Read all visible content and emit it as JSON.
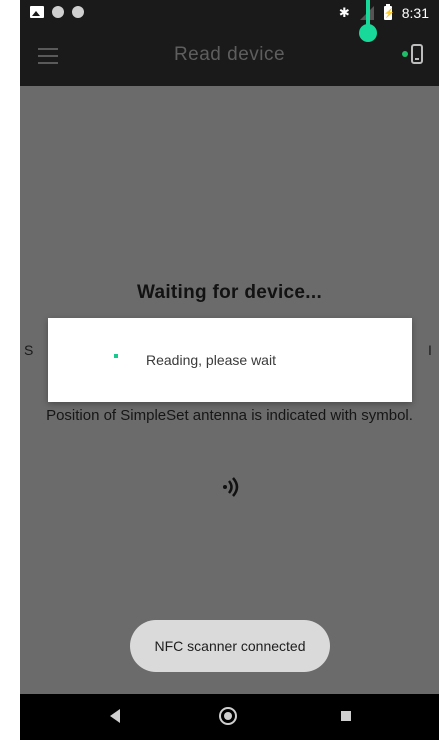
{
  "status_bar": {
    "time": "8:31",
    "bluetooth_icon": "bluetooth-icon"
  },
  "app_bar": {
    "title": "Read device",
    "menu_icon": "hamburger-menu-icon",
    "device_status_color": "#1fbf6a"
  },
  "content": {
    "waiting_title": "Waiting for device...",
    "obscured_left": "S",
    "obscured_right": "I",
    "position_text": "Position of SimpleSet antenna is indicated with symbol."
  },
  "dialog": {
    "text": "Reading, please wait",
    "spinner_color": "#18c98f"
  },
  "toast": {
    "text": "NFC scanner connected"
  },
  "colors": {
    "accent": "#18d99a",
    "overlay": "#6b6b6b",
    "bar": "#1a1a1a"
  }
}
